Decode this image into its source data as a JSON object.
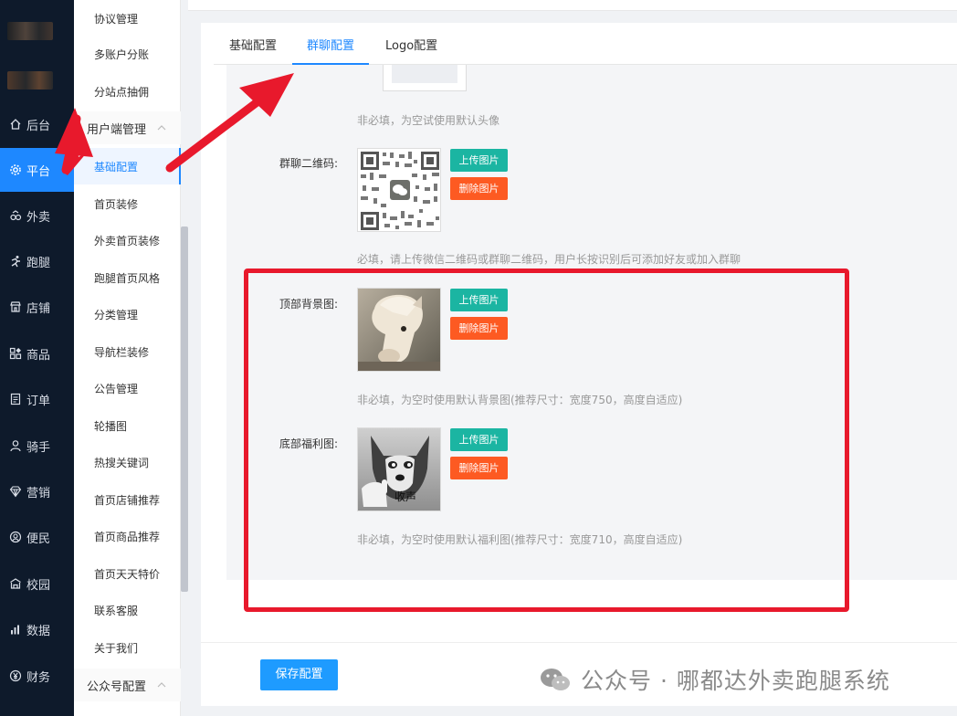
{
  "nav": {
    "items": [
      {
        "label": "后台",
        "icon": "home-icon"
      },
      {
        "label": "平台",
        "icon": "gear-icon"
      },
      {
        "label": "外卖",
        "icon": "takeout-icon"
      },
      {
        "label": "跑腿",
        "icon": "runner-icon"
      },
      {
        "label": "店铺",
        "icon": "store-icon"
      },
      {
        "label": "商品",
        "icon": "goods-icon"
      },
      {
        "label": "订单",
        "icon": "order-icon"
      },
      {
        "label": "骑手",
        "icon": "rider-icon"
      },
      {
        "label": "营销",
        "icon": "diamond-icon"
      },
      {
        "label": "便民",
        "icon": "service-icon"
      },
      {
        "label": "校园",
        "icon": "campus-icon"
      },
      {
        "label": "数据",
        "icon": "chart-icon"
      },
      {
        "label": "财务",
        "icon": "yen-icon"
      }
    ],
    "active_index": 1
  },
  "submenu": {
    "items_top": [
      "协议管理",
      "多账户分账",
      "分站点抽佣"
    ],
    "group1": "用户端管理",
    "items": [
      "基础配置",
      "首页装修",
      "外卖首页装修",
      "跑腿首页风格",
      "分类管理",
      "导航栏装修",
      "公告管理",
      "轮播图",
      "热搜关键词",
      "首页店铺推荐",
      "首页商品推荐",
      "首页天天特价",
      "联系客服",
      "关于我们"
    ],
    "group2": "公众号配置"
  },
  "tabs": [
    "基础配置",
    "群聊配置",
    "Logo配置"
  ],
  "active_tab": 1,
  "form": {
    "avatar_hint": "非必填，为空试使用默认头像",
    "qrcode_label": "群聊二维码:",
    "qrcode_hint": "必填，请上传微信二维码或群聊二维码，用户长按识别后可添加好友或加入群聊",
    "topbg_label": "顶部背景图:",
    "topbg_hint": "非必填，为空时使用默认背景图(推荐尺寸：宽度750，高度自适应)",
    "bottom_label": "底部福利图:",
    "bottom_hint": "非必填，为空时使用默认福利图(推荐尺寸：宽度710，高度自适应)",
    "upload_label": "上传图片",
    "delete_label": "删除图片",
    "dog_caption": "收声"
  },
  "footer": {
    "save_label": "保存配置",
    "watermark": "公众号 · 哪都达外卖跑腿系统"
  },
  "colors": {
    "nav_bg": "#0e1a2b",
    "accent": "#1e88ff",
    "upload": "#1bb5a2",
    "delete": "#fd5a22",
    "annotation": "#e8192c"
  }
}
